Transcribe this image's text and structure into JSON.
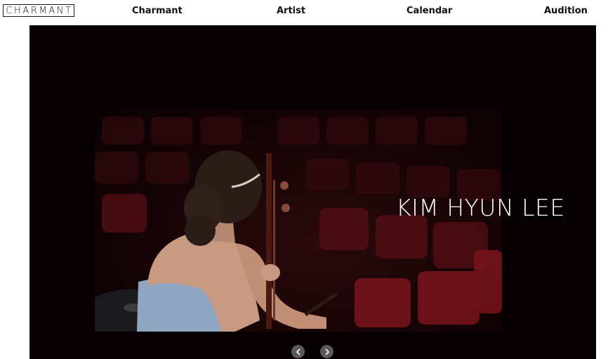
{
  "header": {
    "logo_text": "CHARMANT",
    "nav": {
      "charmant": "Charmant",
      "artist": "Artist",
      "calendar": "Calendar",
      "audition": "Audition"
    }
  },
  "hero": {
    "title": "KIM HYUN LEE",
    "prev_icon": "chevron-left-icon",
    "next_icon": "chevron-right-icon",
    "photo": "performer-with-instrument-photo"
  },
  "colors": {
    "background": "#ffffff",
    "hero_background": "#060002",
    "text": "#111111",
    "hero_text": "#ffffff",
    "slider_button": "#5a5a5a"
  }
}
